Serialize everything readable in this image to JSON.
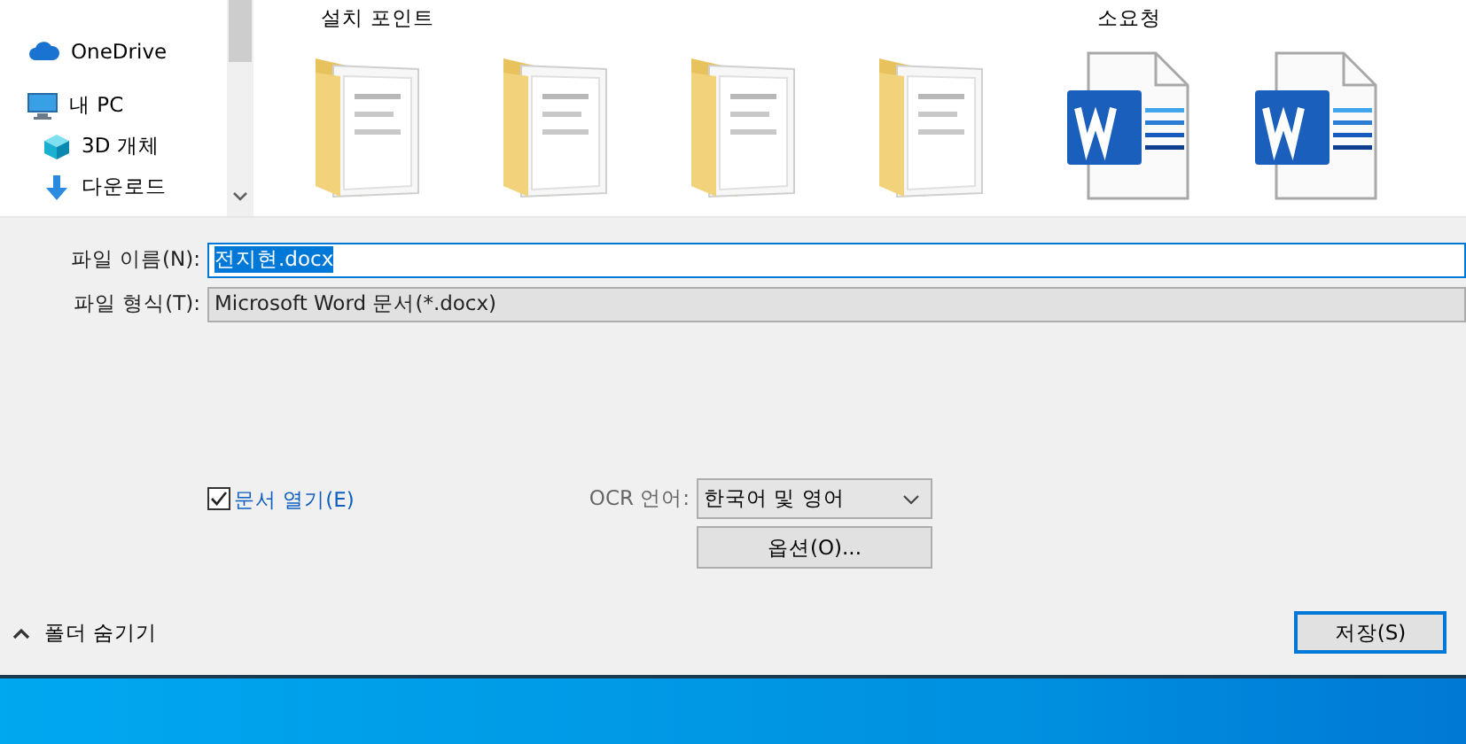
{
  "sidebar": {
    "items": [
      {
        "label": "OneDrive",
        "kind": "cloud"
      },
      {
        "label": "내 PC",
        "kind": "pc"
      },
      {
        "label": "3D 개체",
        "kind": "cube"
      },
      {
        "label": "다운로드",
        "kind": "download"
      }
    ]
  },
  "files": [
    {
      "name": "설치 포인트",
      "kind": "folder"
    },
    {
      "kind": "folder"
    },
    {
      "kind": "folder"
    },
    {
      "kind": "folder"
    },
    {
      "name": "소요청",
      "kind": "word"
    },
    {
      "kind": "word"
    }
  ],
  "file_name": {
    "label": "파일 이름(N):",
    "value": "전지현.docx",
    "selected": true
  },
  "file_type": {
    "label": "파일 형식(T):",
    "value": "Microsoft Word 문서(*.docx)"
  },
  "open_document": {
    "label": "문서 열기(E)",
    "checked": true
  },
  "ocr": {
    "label": "OCR 언어:",
    "value": "한국어 및 영어"
  },
  "options_button": "옵션(O)...",
  "hide_folders": "폴더 숨기기",
  "save_button": "저장(S)"
}
